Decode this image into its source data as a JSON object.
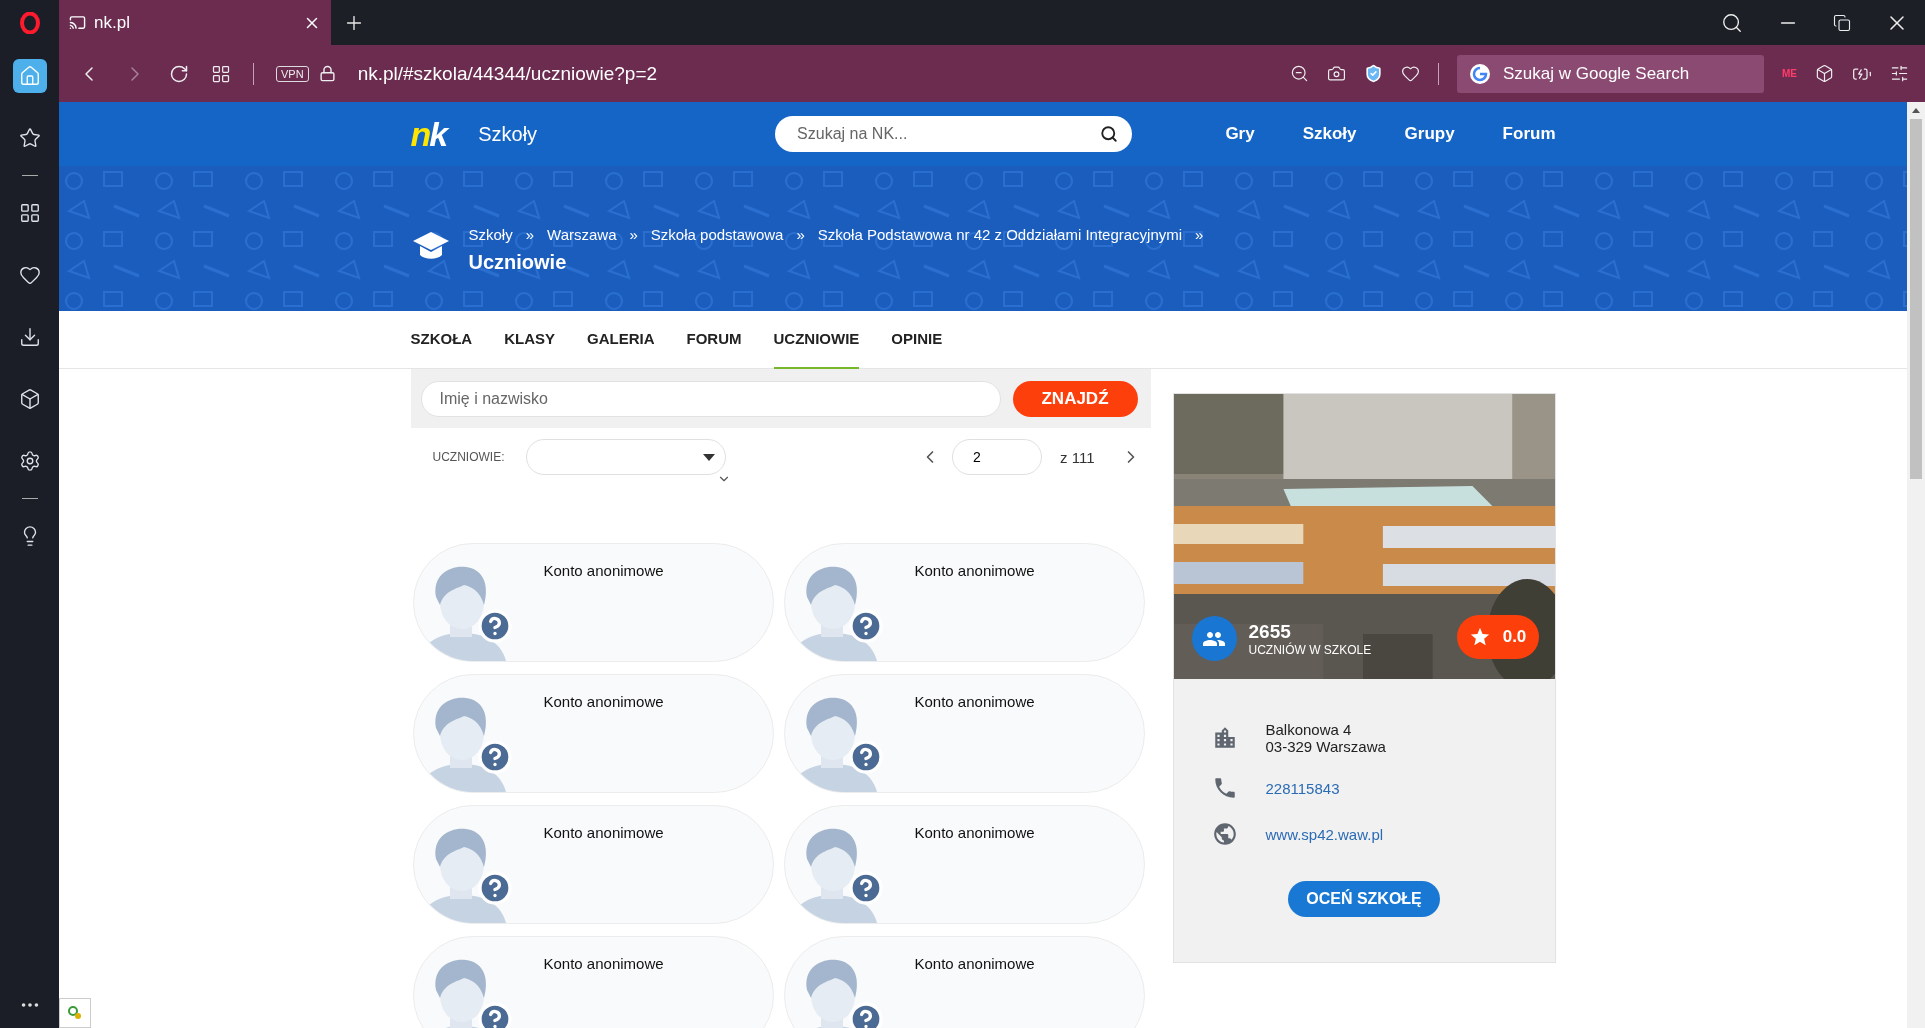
{
  "browser": {
    "tab": {
      "title": "nk.pl",
      "selected": true
    },
    "url": "nk.pl/#szkola/44344/uczniowie?p=2",
    "vpn": "VPN",
    "search": {
      "placeholder": "Szukaj w Google Search"
    },
    "extension_badge": "ME"
  },
  "sidebar": {
    "items": [
      {
        "selected": true
      },
      {
        "selected": false
      },
      {
        "selected": false
      },
      {
        "selected": false
      },
      {
        "selected": false
      },
      {
        "selected": false
      },
      {
        "selected": false
      },
      {
        "selected": false
      }
    ]
  },
  "header": {
    "logo": "nk",
    "section": "Szkoły",
    "search": {
      "placeholder": "Szukaj na NK..."
    },
    "nav": [
      "Gry",
      "Szkoły",
      "Grupy",
      "Forum"
    ]
  },
  "breadcrumb": [
    {
      "label": "Szkoły",
      "sep": "»"
    },
    {
      "label": "Warszawa",
      "sep": "»"
    },
    {
      "label": "Szkoła podstawowa",
      "sep": "»"
    },
    {
      "label": "Szkoła Podstawowa nr 42 z Oddziałami Integracyjnymi",
      "sep": "»"
    }
  ],
  "page_title": "Uczniowie",
  "tabs": [
    {
      "label": "SZKOŁA",
      "selected": false
    },
    {
      "label": "KLASY",
      "selected": false
    },
    {
      "label": "GALERIA",
      "selected": false
    },
    {
      "label": "FORUM",
      "selected": false
    },
    {
      "label": "UCZNIOWIE",
      "selected": true
    },
    {
      "label": "OPINIE",
      "selected": false
    }
  ],
  "student_search": {
    "placeholder": "Imię i nazwisko",
    "button": "ZNAJDŹ"
  },
  "filter": {
    "label": "UCZNIOWIE:"
  },
  "pagination": {
    "page": "2",
    "total": "z 111"
  },
  "students": [
    {
      "name": "Konto anonimowe"
    },
    {
      "name": "Konto anonimowe"
    },
    {
      "name": "Konto anonimowe"
    },
    {
      "name": "Konto anonimowe"
    },
    {
      "name": "Konto anonimowe"
    },
    {
      "name": "Konto anonimowe"
    },
    {
      "name": "Konto anonimowe"
    },
    {
      "name": "Konto anonimowe"
    }
  ],
  "school": {
    "students_count": "2655",
    "students_caption": "UCZNIÓW W SZKOLE",
    "rating": "0.0",
    "address": [
      "Balkonowa 4",
      "03-329 Warszawa"
    ],
    "phone": "228115843",
    "website": "www.sp42.waw.pl",
    "rate_button": "OCEŃ SZKOŁĘ"
  }
}
